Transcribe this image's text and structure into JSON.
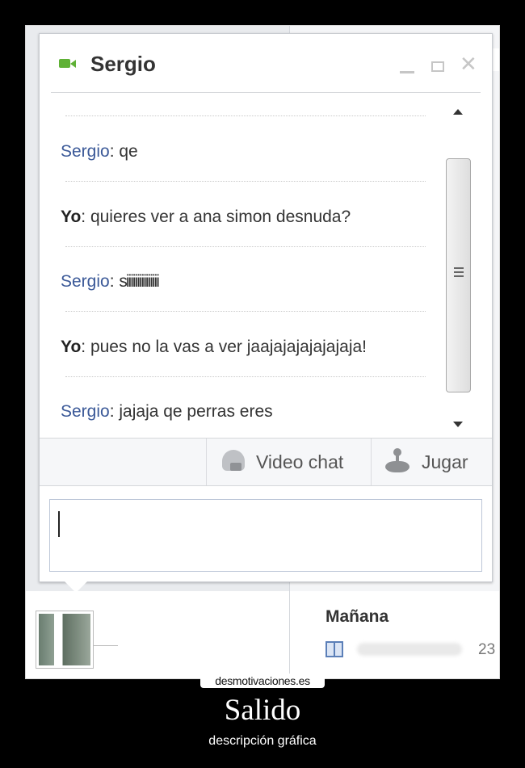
{
  "chat": {
    "contact_name": "Sergio",
    "messages": [
      {
        "sender": "Sergio",
        "text": "qe"
      },
      {
        "sender": "Yo",
        "text": "quieres ver a ana simon desnuda?"
      },
      {
        "sender": "Sergio",
        "text": "siiiiiiiiiiiiiii"
      },
      {
        "sender": "Yo",
        "text": "pues no la vas a ver jaajajajajajajaja!"
      },
      {
        "sender": "Sergio",
        "text": "jajaja qe perras eres"
      }
    ],
    "toolbar": {
      "video_chat_label": "Video chat",
      "play_label": "Jugar"
    },
    "input": {
      "value": ""
    }
  },
  "background": {
    "section_title": "Mañana",
    "birthday_number": "23"
  },
  "poster": {
    "site": "desmotivaciones.es",
    "title": "Salido",
    "subtitle": "descripción gráfica"
  },
  "icons": [
    "video-camera-icon",
    "minimize-icon",
    "maximize-icon",
    "close-icon",
    "video-chat-icon",
    "game-icon",
    "gift-icon"
  ],
  "colors": {
    "sender_other": "#3b5998",
    "sender_self": "#222222",
    "online": "#5fb136"
  }
}
